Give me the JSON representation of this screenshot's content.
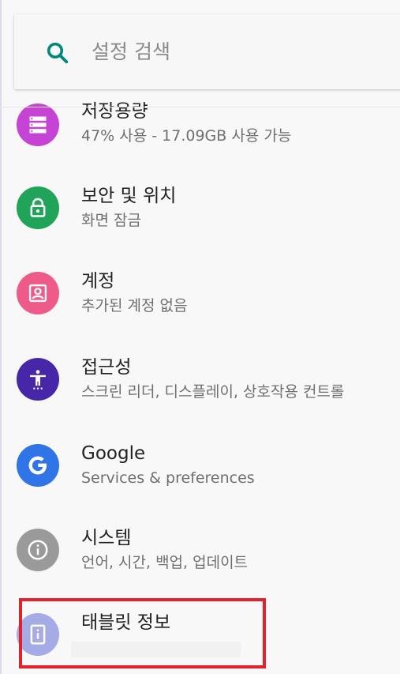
{
  "search": {
    "placeholder": "설정 검색",
    "icon": "search-icon"
  },
  "settings_items": [
    {
      "id": "storage",
      "title": "저장용량",
      "subtitle": "47% 사용 - 17.09GB 사용 가능",
      "icon": "storage-icon",
      "icon_color": "#c544d6"
    },
    {
      "id": "security",
      "title": "보안 및 위치",
      "subtitle": "화면 잠금",
      "icon": "lock-icon",
      "icon_color": "#1fa45a"
    },
    {
      "id": "accounts",
      "title": "계정",
      "subtitle": "추가된 계정 없음",
      "icon": "account-icon",
      "icon_color": "#ef5b88"
    },
    {
      "id": "accessibility",
      "title": "접근성",
      "subtitle": "스크린 리더, 디스플레이, 상호작용 컨트롤",
      "icon": "accessibility-icon",
      "icon_color": "#4727a7"
    },
    {
      "id": "google",
      "title": "Google",
      "subtitle": "Services & preferences",
      "icon": "google-icon",
      "icon_color": "#2f75e7"
    },
    {
      "id": "system",
      "title": "시스템",
      "subtitle": "언어, 시간, 백업, 업데이트",
      "icon": "info-icon",
      "icon_color": "#9a9a9a"
    },
    {
      "id": "about_tablet",
      "title": "태블릿 정보",
      "subtitle": "",
      "icon": "tablet-info-icon",
      "icon_color": "#a5abe6",
      "highlighted": true
    }
  ],
  "colors": {
    "accent": "#00897b",
    "highlight": "#e3202b",
    "background": "#f8f8f8"
  }
}
